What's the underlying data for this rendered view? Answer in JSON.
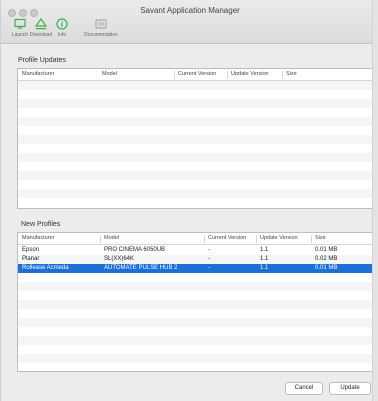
{
  "window": {
    "title": "Savant Application Manager"
  },
  "toolbar": [
    {
      "label": "Launch",
      "icon": "monitor-icon"
    },
    {
      "label": "Download",
      "icon": "download-icon"
    },
    {
      "label": "Info",
      "icon": "info-icon"
    },
    {
      "label": "Documentation",
      "icon": "document-icon"
    }
  ],
  "profile_updates": {
    "title": "Profile Updates",
    "columns": [
      "Manufacturer",
      "Model",
      "Current Version",
      "Update Version",
      "Size"
    ],
    "rows": []
  },
  "new_profiles": {
    "title": "New Profiles",
    "columns": [
      "Manufacturer",
      "Model",
      "Current Version",
      "Update Version",
      "Size"
    ],
    "rows": [
      {
        "manufacturer": "Epson",
        "model": "PRO CINEMA 6050UB",
        "current": "-",
        "update": "1.1",
        "size": "0.01 MB"
      },
      {
        "manufacturer": "Planar",
        "model": "SL(XX)64K",
        "current": "-",
        "update": "1.1",
        "size": "0.02 MB"
      },
      {
        "manufacturer": "Rollease Acmeda",
        "model": "AUTOMATE PULSE HUB 2",
        "current": "-",
        "update": "1.1",
        "size": "0.01 MB"
      }
    ],
    "selected_index": 2
  },
  "buttons": {
    "cancel": "Cancel",
    "update": "Update"
  },
  "colors": {
    "selection": "#1d6fd8",
    "accent_green": "#3bb14a"
  }
}
